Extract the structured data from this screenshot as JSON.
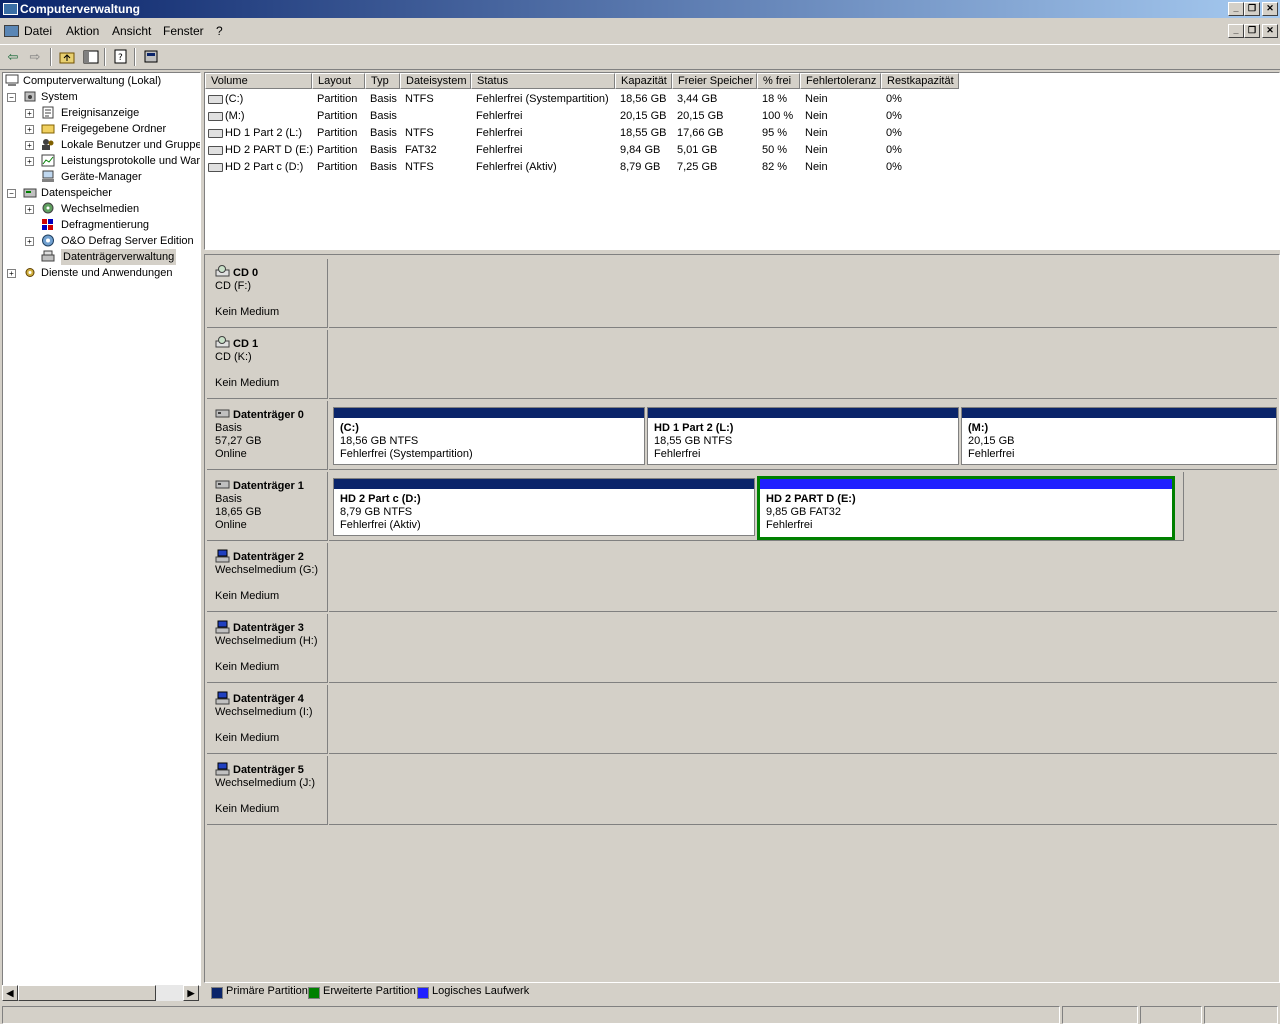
{
  "window": {
    "title": "Computerverwaltung",
    "colors": {
      "primary": "#0a246a",
      "logical": "#2020ff",
      "extended": "#008000",
      "titlebar_start": "#0a246a",
      "titlebar_end": "#a6caf0"
    }
  },
  "menu": [
    "Datei",
    "Aktion",
    "Ansicht",
    "Fenster",
    "?"
  ],
  "toolbar": [
    "back-icon",
    "forward-icon",
    "up-folder-icon",
    "show-hide-tree-icon",
    "properties-icon",
    "help-icon"
  ],
  "tree": {
    "root": "Computerverwaltung (Lokal)",
    "system": "System",
    "system_items": [
      "Ereignisanzeige",
      "Freigegebene Ordner",
      "Lokale Benutzer und Gruppen",
      "Leistungsprotokolle und Warnungen",
      "Geräte-Manager"
    ],
    "storage": "Datenspeicher",
    "storage_items": [
      "Wechselmedien",
      "Defragmentierung",
      "O&O Defrag Server Edition",
      "Datenträgerverwaltung"
    ],
    "services": "Dienste und Anwendungen"
  },
  "volume_list": {
    "headers": [
      "Volume",
      "Layout",
      "Typ",
      "Dateisystem",
      "Status",
      "Kapazität",
      "Freier Speicher",
      "% frei",
      "Fehlertoleranz",
      "Restkapazität"
    ],
    "rows": [
      [
        "(C:)",
        "Partition",
        "Basis",
        "NTFS",
        "Fehlerfrei (Systempartition)",
        "18,56 GB",
        "3,44 GB",
        "18 %",
        "Nein",
        "0%"
      ],
      [
        "(M:)",
        "Partition",
        "Basis",
        "",
        "Fehlerfrei",
        "20,15 GB",
        "20,15 GB",
        "100 %",
        "Nein",
        "0%"
      ],
      [
        "HD 1 Part 2 (L:)",
        "Partition",
        "Basis",
        "NTFS",
        "Fehlerfrei",
        "18,55 GB",
        "17,66 GB",
        "95 %",
        "Nein",
        "0%"
      ],
      [
        "HD 2 PART D (E:)",
        "Partition",
        "Basis",
        "FAT32",
        "Fehlerfrei",
        "9,84 GB",
        "5,01 GB",
        "50 %",
        "Nein",
        "0%"
      ],
      [
        "HD 2 Part c (D:)",
        "Partition",
        "Basis",
        "NTFS",
        "Fehlerfrei (Aktiv)",
        "8,79 GB",
        "7,25 GB",
        "82 %",
        "Nein",
        "0%"
      ]
    ]
  },
  "disks": [
    {
      "name": "CD 0",
      "line1": "CD (F:)",
      "line2": "",
      "line3": "Kein Medium",
      "icon": "cd-drive-icon"
    },
    {
      "name": "CD 1",
      "line1": "CD (K:)",
      "line2": "",
      "line3": "Kein Medium",
      "icon": "cd-drive-icon"
    },
    {
      "name": "Datenträger 0",
      "line1": "Basis",
      "line2": "57,27 GB",
      "line3": "Online",
      "icon": "hard-disk-icon",
      "partitions": [
        {
          "title": "(C:)",
          "size": "18,56 GB NTFS",
          "status": "Fehlerfrei (Systempartition)",
          "kind": "primary"
        },
        {
          "title": "HD 1 Part 2  (L:)",
          "size": "18,55 GB NTFS",
          "status": "Fehlerfrei",
          "kind": "primary"
        },
        {
          "title": "(M:)",
          "size": "20,15 GB",
          "status": "Fehlerfrei",
          "kind": "primary"
        }
      ]
    },
    {
      "name": "Datenträger 1",
      "line1": "Basis",
      "line2": "18,65 GB",
      "line3": "Online",
      "icon": "hard-disk-icon",
      "partitions": [
        {
          "title": "HD 2 Part c  (D:)",
          "size": "8,79 GB NTFS",
          "status": "Fehlerfrei (Aktiv)",
          "kind": "primary"
        },
        {
          "title": "HD 2 PART D  (E:)",
          "size": "9,85 GB FAT32",
          "status": "Fehlerfrei",
          "kind": "logical"
        }
      ]
    },
    {
      "name": "Datenträger 2",
      "line1": "Wechselmedium (G:)",
      "line2": "",
      "line3": "Kein Medium",
      "icon": "removable-disk-icon"
    },
    {
      "name": "Datenträger 3",
      "line1": "Wechselmedium (H:)",
      "line2": "",
      "line3": "Kein Medium",
      "icon": "removable-disk-icon"
    },
    {
      "name": "Datenträger 4",
      "line1": "Wechselmedium (I:)",
      "line2": "",
      "line3": "Kein Medium",
      "icon": "removable-disk-icon"
    },
    {
      "name": "Datenträger 5",
      "line1": "Wechselmedium (J:)",
      "line2": "",
      "line3": "Kein Medium",
      "icon": "removable-disk-icon"
    }
  ],
  "legend": [
    "Primäre Partition",
    "Erweiterte Partition",
    "Logisches Laufwerk"
  ]
}
